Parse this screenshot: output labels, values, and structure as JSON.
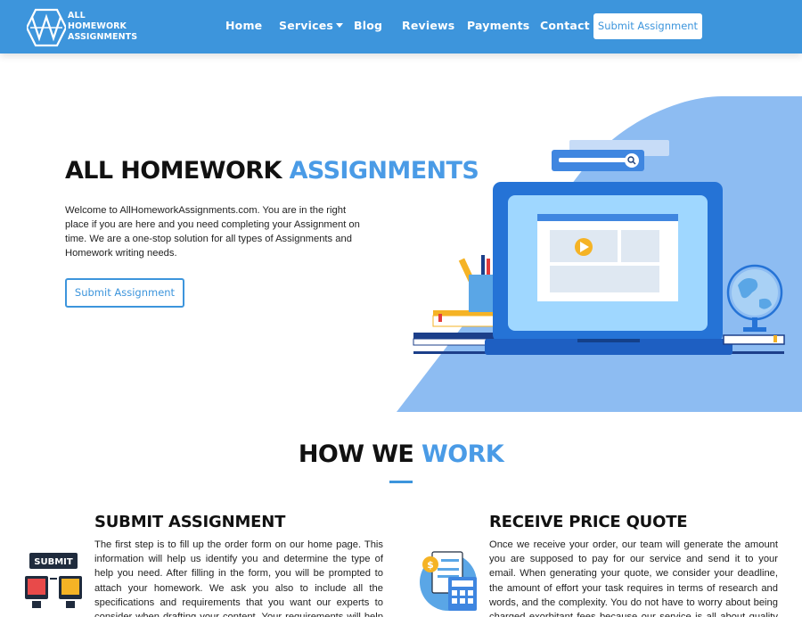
{
  "logo": {
    "line1": "ALL",
    "line2": "HOMEWORK",
    "line3": "ASSIGNMENTS"
  },
  "nav": {
    "home": "Home",
    "services": "Services",
    "blog": "Blog",
    "reviews": "Reviews",
    "payments": "Payments",
    "contact": "Contact",
    "cta": "Submit Assignment"
  },
  "hero": {
    "title_dark": "ALL HOMEWORK",
    "title_accent": "ASSIGNMENTS",
    "description": "Welcome to AllHomeworkAssignments.com. You are in the right place if you are here and you need completing your Assignment on time. We are a one-stop solution for all types of Assignments and Homework writing needs.",
    "button": "Submit Assignment"
  },
  "how": {
    "title_dark": "HOW WE",
    "title_accent": "WORK",
    "steps": [
      {
        "title": "SUBMIT ASSIGNMENT",
        "icon_label": "SUBMIT",
        "text": "The first step is to fill up the order form on our home page. This information will help us identify you and determine the type of help you need. After filling in the form, you will be prompted to attach your homework. We ask you also to include all the specifications and requirements that you want our experts to consider when drafting your content. Your requirements will help our professional homework"
      },
      {
        "title": "RECEIVE PRICE QUOTE",
        "icon_label": "$",
        "text": "Once we receive your order, our team will generate the amount you are supposed to pay for our service and send it to your email. When generating your quote, we consider your deadline, the amount of effort your task requires in terms of research and words, and the complexity. You do not have to worry about being charged exorbitant fees because our service is all about quality content at competitive"
      }
    ]
  },
  "colors": {
    "brand": "#3d95dc",
    "accent": "#4a9be6"
  }
}
